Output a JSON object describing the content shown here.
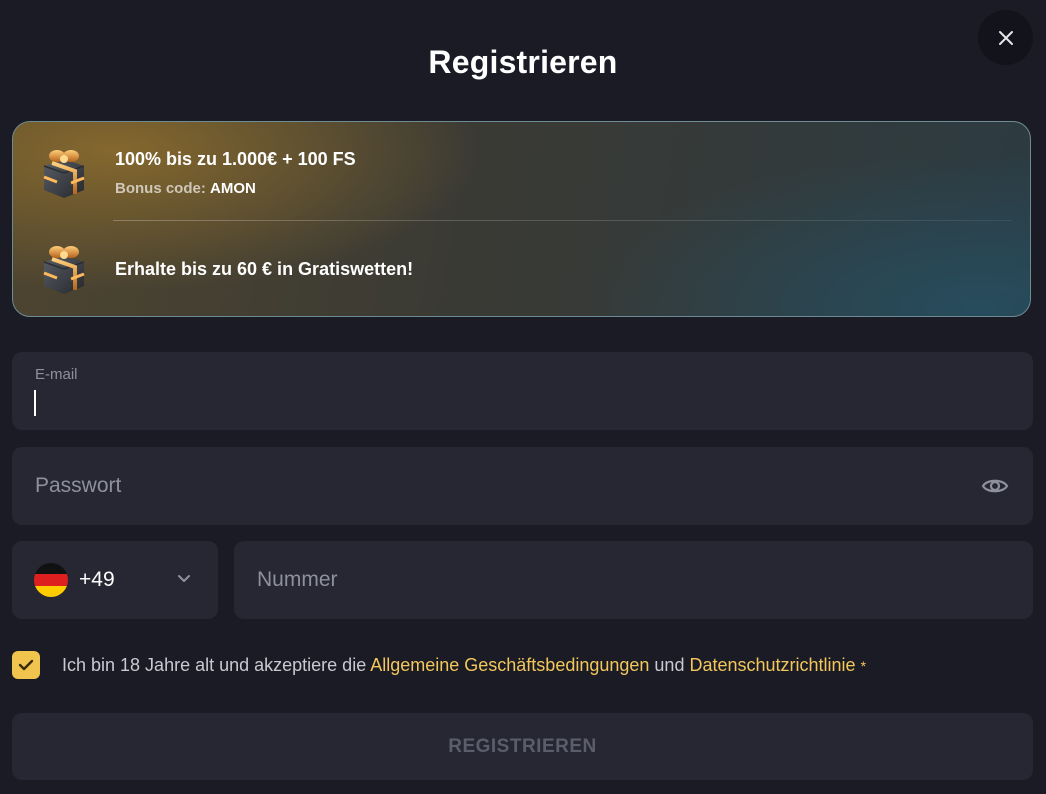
{
  "dialog": {
    "title": "Registrieren",
    "close_icon": "close-icon"
  },
  "promo": {
    "items": [
      {
        "icon": "gift-icon",
        "main": "100% bis zu 1.000€ + 100 FS",
        "sub_label": "Bonus code:",
        "sub_value": "AMON"
      },
      {
        "icon": "gift-icon",
        "main": "Erhalte bis zu 60 € in Gratiswetten!"
      }
    ]
  },
  "form": {
    "email": {
      "label": "E-mail",
      "value": ""
    },
    "password": {
      "placeholder": "Passwort",
      "toggle_icon": "eye-icon"
    },
    "phone": {
      "country_code": "+49",
      "flag": "germany-flag-icon",
      "number_placeholder": "Nummer"
    },
    "terms": {
      "checked": true,
      "text_before": "Ich bin 18 Jahre alt und akzeptiere die ",
      "link_terms": "Allgemeine Geschäftsbedingungen",
      "text_middle": " und ",
      "link_privacy": "Datenschutzrichtlinie",
      "required_mark": "*"
    },
    "submit_label": "REGISTRIEREN"
  },
  "colors": {
    "background": "#1a1b24",
    "field": "#262733",
    "accent": "#f1c44e",
    "placeholder": "#8f909d"
  }
}
